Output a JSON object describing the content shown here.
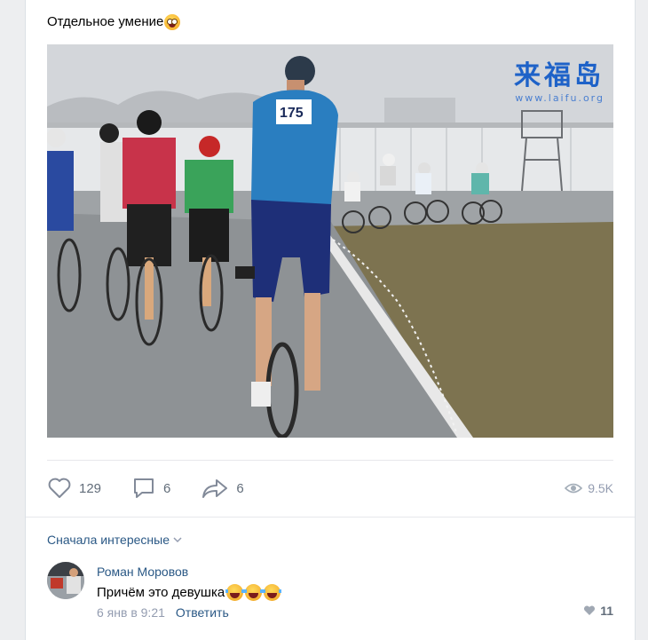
{
  "post": {
    "text": "Отдельное умение",
    "emoji": "crazy-face-emoji",
    "watermark": {
      "brand": "来福岛",
      "url": "www.laifu.org"
    }
  },
  "actions": {
    "likes": "129",
    "comments": "6",
    "shares": "6",
    "views": "9.5K"
  },
  "comments_section": {
    "sort_label": "Сначала интересные"
  },
  "comment": {
    "author": "Роман Моровов",
    "text": "Причём это девушка",
    "emojis": [
      "laughing-tears-emoji",
      "laughing-tears-emoji",
      "laughing-tears-emoji"
    ],
    "date": "6 янв в 9:21",
    "reply_label": "Ответить",
    "likes": "11"
  },
  "colors": {
    "link": "#2a5885",
    "muted": "#939cb0",
    "icon": "#626d7a"
  }
}
